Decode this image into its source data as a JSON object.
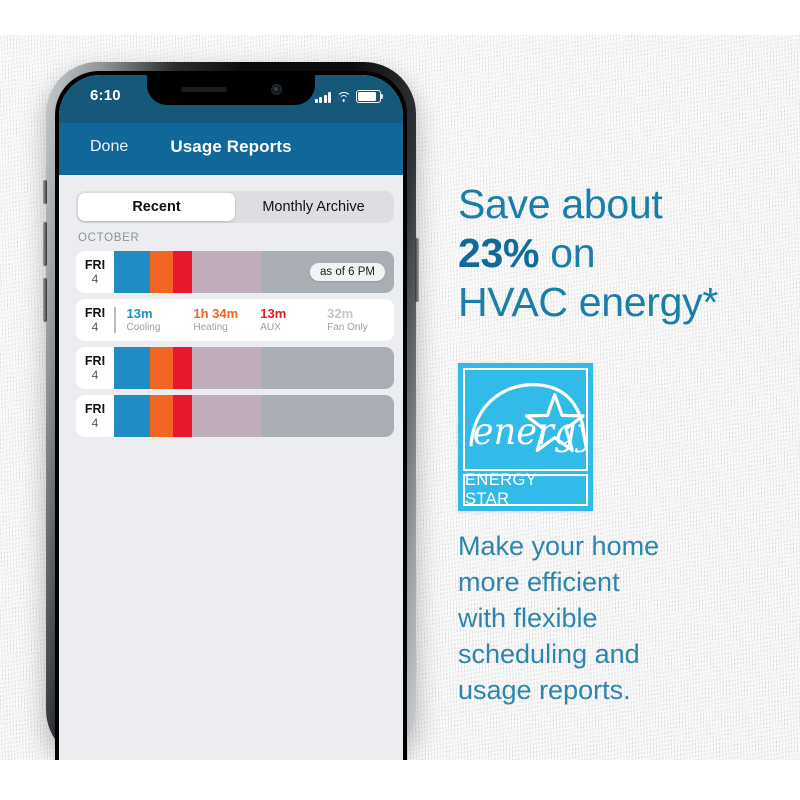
{
  "phone": {
    "status_bar": {
      "time": "6:10",
      "icons": [
        "signal-bars-icon",
        "wifi-icon",
        "battery-icon"
      ]
    },
    "nav": {
      "back_label": "Done",
      "title": "Usage Reports"
    },
    "segmented_control": {
      "options": [
        "Recent",
        "Monthly Archive"
      ],
      "selected": "Recent"
    },
    "section_header": "OCTOBER",
    "rows": [
      {
        "dow": "FRI",
        "num": "4",
        "type": "bar",
        "pill": "as of 6 PM",
        "segments": [
          {
            "name": "cooling",
            "color": "#1f8cc4",
            "pct": 13
          },
          {
            "name": "heating",
            "color": "#f26522",
            "pct": 8
          },
          {
            "name": "aux",
            "color": "#e8192c",
            "pct": 7
          },
          {
            "name": "fan-only",
            "color": "#bfadbb",
            "pct": 25
          },
          {
            "name": "idle",
            "color": "#a9aeb4",
            "pct": 47
          }
        ]
      },
      {
        "dow": "FRI",
        "num": "4",
        "type": "legend",
        "legend": [
          {
            "value": "13m",
            "caption": "Cooling",
            "color": "#1f8cc4"
          },
          {
            "value": "1h 34m",
            "caption": "Heating",
            "color": "#f26522"
          },
          {
            "value": "13m",
            "caption": "AUX",
            "color": "#e8192c"
          },
          {
            "value": "32m",
            "caption": "Fan Only",
            "color": "#c3c6ca"
          }
        ]
      },
      {
        "dow": "FRI",
        "num": "4",
        "type": "bar",
        "pill": "",
        "segments": [
          {
            "name": "cooling",
            "color": "#1f8cc4",
            "pct": 13
          },
          {
            "name": "heating",
            "color": "#f26522",
            "pct": 8
          },
          {
            "name": "aux",
            "color": "#e8192c",
            "pct": 7
          },
          {
            "name": "fan-only",
            "color": "#bfadbb",
            "pct": 25
          },
          {
            "name": "idle",
            "color": "#a9aeb4",
            "pct": 47
          }
        ]
      },
      {
        "dow": "FRI",
        "num": "4",
        "type": "bar",
        "pill": "",
        "segments": [
          {
            "name": "cooling",
            "color": "#1f8cc4",
            "pct": 13
          },
          {
            "name": "heating",
            "color": "#f26522",
            "pct": 8
          },
          {
            "name": "aux",
            "color": "#e8192c",
            "pct": 7
          },
          {
            "name": "fan-only",
            "color": "#bfadbb",
            "pct": 25
          },
          {
            "name": "idle",
            "color": "#a9aeb4",
            "pct": 47
          }
        ]
      }
    ]
  },
  "marketing": {
    "headline_line1": "Save about",
    "headline_stat": "23%",
    "headline_line2_rest": " on",
    "headline_line3": "HVAC energy*",
    "badge": {
      "script_text": "energy",
      "wordmark": "ENERGY STAR",
      "color": "#32bbe8"
    },
    "body_lines": [
      "Make your home",
      "more efficient",
      "with flexible",
      "scheduling and",
      "usage reports."
    ]
  },
  "colors": {
    "status_bar_blue": "#16587a",
    "nav_blue": "#12679a",
    "headline_blue": "#1a7fa8",
    "stat_blue": "#0d6c99",
    "body_blue": "#2d86ab",
    "screen_bg": "#ecedf0"
  }
}
